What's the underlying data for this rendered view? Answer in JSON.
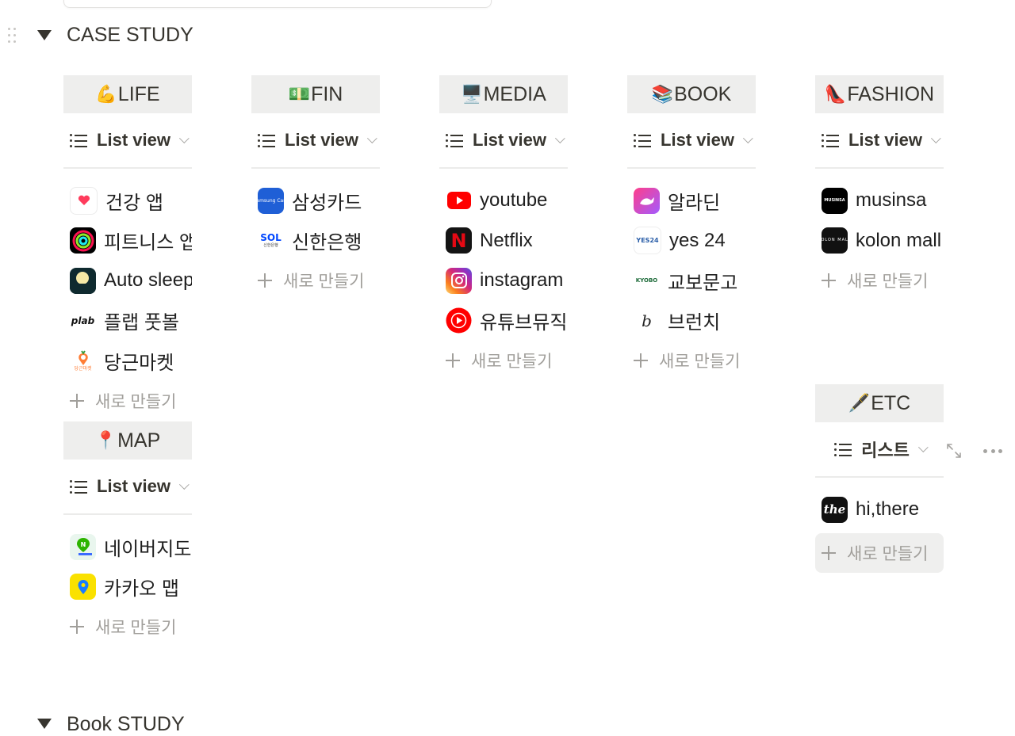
{
  "sections": {
    "case_study": {
      "title": "CASE STUDY"
    },
    "book_study": {
      "title": "Book STUDY"
    }
  },
  "boards": {
    "life": {
      "emoji": "💪",
      "title": "LIFE",
      "view_label": "List view",
      "items": [
        {
          "label": "건강 앱",
          "icon": "health-app-icon"
        },
        {
          "label": "피트니스 앱",
          "icon": "fitness-app-icon"
        },
        {
          "label": "Auto sleep",
          "icon": "autosleep-app-icon"
        },
        {
          "label": "플랩 풋볼",
          "icon": "plab-logo-icon",
          "icon_text": "plab"
        },
        {
          "label": "당근마켓",
          "icon": "carrot-market-icon",
          "icon_text": "당근마켓"
        }
      ],
      "new_label": "새로 만들기"
    },
    "fin": {
      "emoji": "💵",
      "title": "FIN",
      "view_label": "List view",
      "items": [
        {
          "label": "삼성카드",
          "icon": "samsung-card-icon",
          "icon_text": "Samsung Card"
        },
        {
          "label": "신한은행",
          "icon": "shinhan-sol-icon",
          "icon_text": "SOL",
          "icon_subtext": "신한은행"
        }
      ],
      "new_label": "새로 만들기"
    },
    "media": {
      "emoji": "🖥️",
      "title": "MEDIA",
      "view_label": "List view",
      "items": [
        {
          "label": "youtube",
          "icon": "youtube-icon"
        },
        {
          "label": "Netflix",
          "icon": "netflix-icon",
          "icon_text": "N"
        },
        {
          "label": "instagram",
          "icon": "instagram-icon"
        },
        {
          "label": "유튜브뮤직",
          "icon": "youtube-music-icon"
        }
      ],
      "new_label": "새로 만들기"
    },
    "book": {
      "emoji": "📚",
      "title": "BOOK",
      "view_label": "List view",
      "items": [
        {
          "label": "알라딘",
          "icon": "aladin-icon"
        },
        {
          "label": "yes 24",
          "icon": "yes24-icon",
          "icon_text": "YES24"
        },
        {
          "label": "교보문고",
          "icon": "kyobo-icon",
          "icon_text": "KYOBO"
        },
        {
          "label": "브런치",
          "icon": "brunch-icon",
          "icon_text": "b"
        }
      ],
      "new_label": "새로 만들기"
    },
    "fashion": {
      "emoji": "👠",
      "title": "FASHION",
      "view_label": "List view",
      "items": [
        {
          "label": "musinsa",
          "icon": "musinsa-icon",
          "icon_text": "MUSINSA"
        },
        {
          "label": "kolon mall",
          "icon": "kolon-mall-icon",
          "icon_text": "KOLON MALL"
        }
      ],
      "new_label": "새로 만들기"
    },
    "map": {
      "emoji": "📍",
      "title": "MAP",
      "view_label": "List view",
      "items": [
        {
          "label": "네이버지도",
          "icon": "naver-map-icon",
          "icon_text": "N"
        },
        {
          "label": "카카오 맵",
          "icon": "kakao-map-icon"
        }
      ],
      "new_label": "새로 만들기"
    },
    "etc": {
      "emoji": "🖋️",
      "title": "ETC",
      "view_label": "리스트",
      "items": [
        {
          "label": "hi,there",
          "icon": "hithere-icon",
          "icon_text": "the"
        }
      ],
      "new_label": "새로 만들기"
    }
  },
  "colors": {
    "header_bg": "#eeeeed",
    "text": "#37352f",
    "muted": "#a19f9b",
    "divider": "#ebebea"
  }
}
